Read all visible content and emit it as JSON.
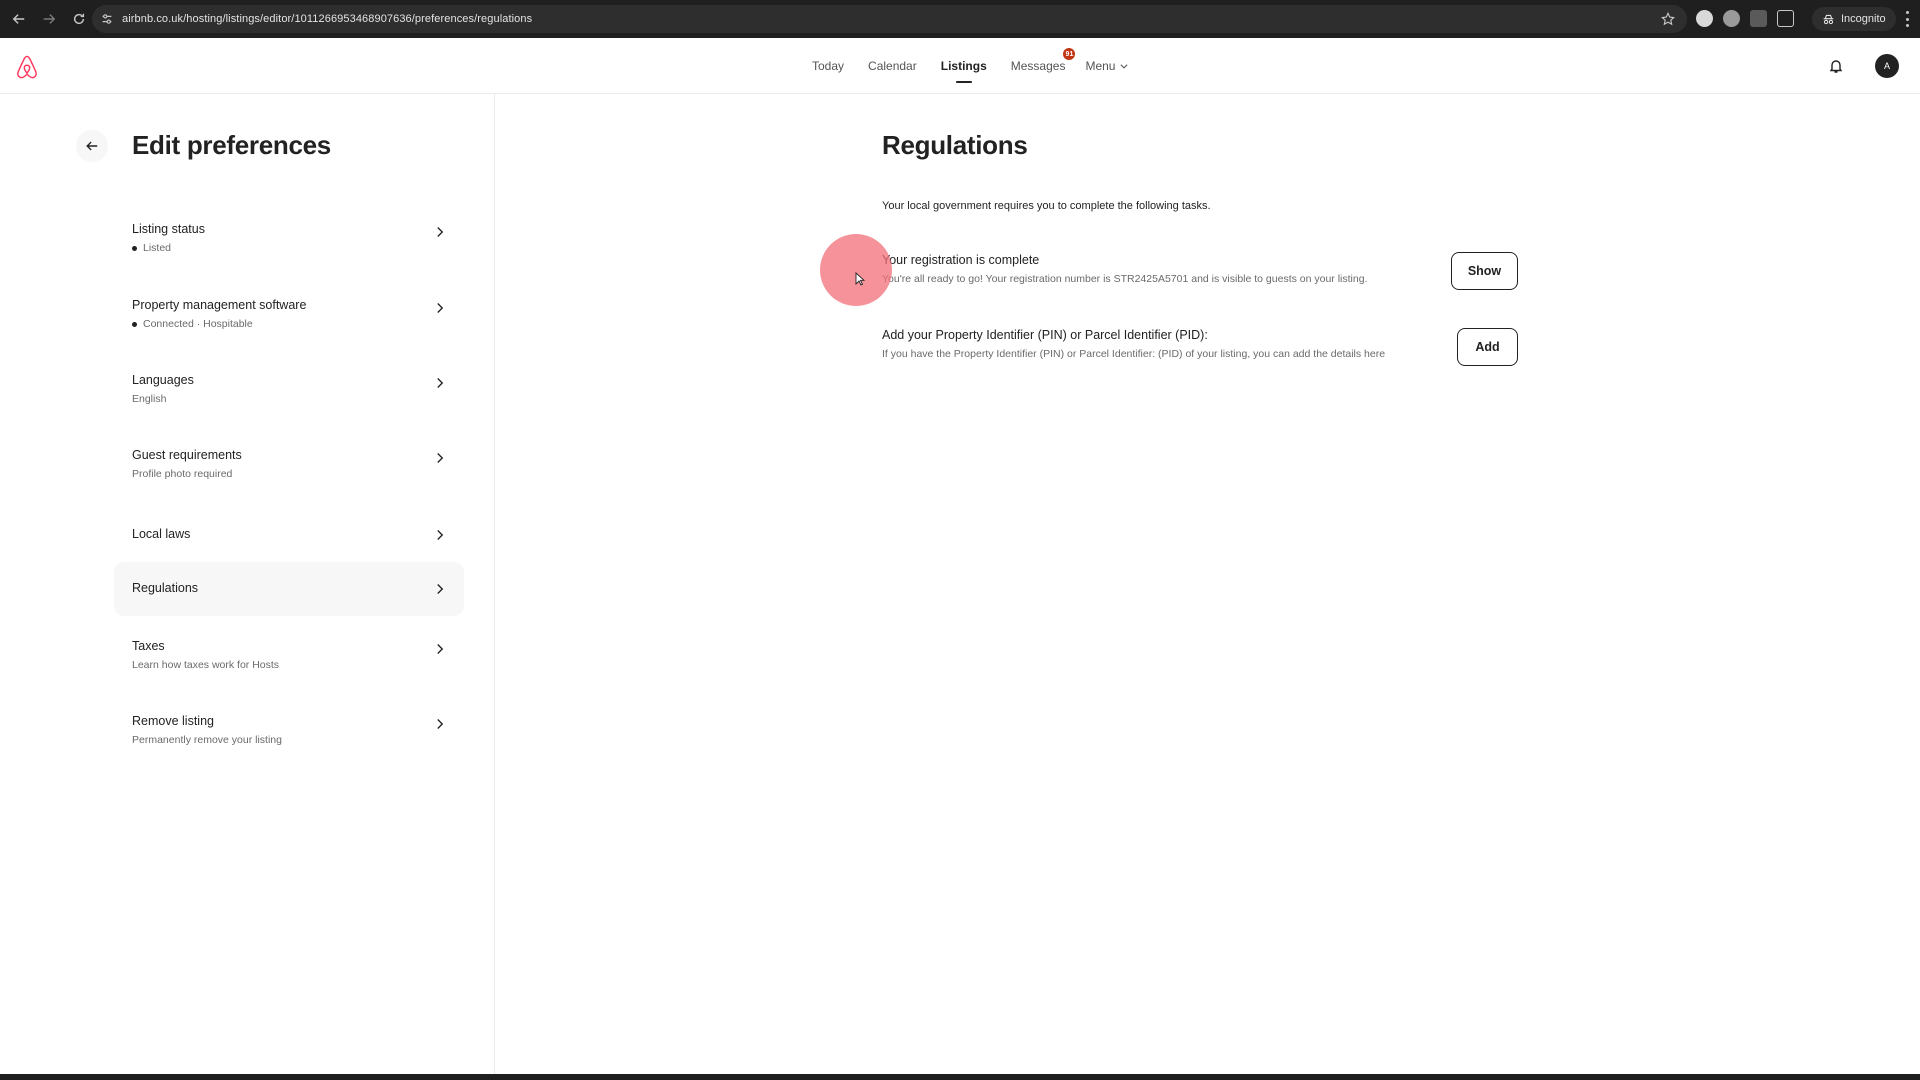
{
  "browser": {
    "url": "airbnb.co.uk/hosting/listings/editor/1011266953468907636/preferences/regulations",
    "incognito_label": "Incognito"
  },
  "header": {
    "nav": [
      {
        "label": "Today"
      },
      {
        "label": "Calendar"
      },
      {
        "label": "Listings"
      },
      {
        "label": "Messages"
      },
      {
        "label": "Menu"
      }
    ],
    "messages_badge": "91",
    "avatar_initial": "A",
    "brand_color": "#FF385C"
  },
  "sidebar": {
    "title": "Edit preferences",
    "items": [
      {
        "label": "Listing status",
        "sub": "Listed",
        "dot": true
      },
      {
        "label": "Property management software",
        "sub": "Connected · Hospitable",
        "dot": true
      },
      {
        "label": "Languages",
        "sub": "English",
        "dot": false
      },
      {
        "label": "Guest requirements",
        "sub": "Profile photo required",
        "dot": false
      },
      {
        "label": "Local laws",
        "sub": "",
        "dot": false
      },
      {
        "label": "Regulations",
        "sub": "",
        "dot": false,
        "selected": true
      },
      {
        "label": "Taxes",
        "sub": "Learn how taxes work for Hosts",
        "dot": false
      },
      {
        "label": "Remove listing",
        "sub": "Permanently remove your listing",
        "dot": false
      }
    ]
  },
  "main": {
    "title": "Regulations",
    "intro": "Your local government requires you to complete the following tasks.",
    "tasks": [
      {
        "title": "Your registration is complete",
        "desc": "You're all ready to go! Your registration number is STR2425A5701 and is visible to guests on your listing.",
        "button": "Show"
      },
      {
        "title": "Add your Property Identifier (PIN) or Parcel Identifier (PID):",
        "desc": "If you have the Property Identifier (PIN) or Parcel Identifier: (PID) of your listing, you can add the details here",
        "button": "Add"
      }
    ]
  }
}
